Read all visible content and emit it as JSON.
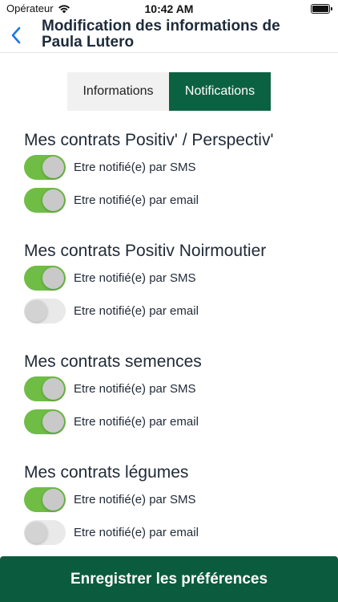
{
  "status_bar": {
    "carrier": "Opérateur",
    "time": "10:42 AM"
  },
  "header": {
    "back_icon": "chevron-left-icon",
    "title": "Modification des informations de Paula Lutero"
  },
  "tabs": [
    {
      "label": "Informations",
      "selected": false
    },
    {
      "label": "Notifications",
      "selected": true
    }
  ],
  "sections": [
    {
      "title": "Mes contrats Positiv' / Perspectiv'",
      "options": [
        {
          "label": "Etre notifié(e) par SMS",
          "enabled": true
        },
        {
          "label": "Etre notifié(e) par email",
          "enabled": true
        }
      ]
    },
    {
      "title": "Mes contrats Positiv Noirmoutier",
      "options": [
        {
          "label": "Etre notifié(e) par SMS",
          "enabled": true
        },
        {
          "label": "Etre notifié(e) par email",
          "enabled": false
        }
      ]
    },
    {
      "title": "Mes contrats semences",
      "options": [
        {
          "label": "Etre notifié(e) par SMS",
          "enabled": true
        },
        {
          "label": "Etre notifié(e) par email",
          "enabled": true
        }
      ]
    },
    {
      "title": "Mes contrats légumes",
      "options": [
        {
          "label": "Etre notifié(e) par SMS",
          "enabled": true
        },
        {
          "label": "Etre notifié(e) par email",
          "enabled": false
        }
      ]
    }
  ],
  "save_button": {
    "label": "Enregistrer les préférences"
  },
  "colors": {
    "brand_green": "#0b6243",
    "toggle_on": "#6fbd45",
    "toggle_off": "#e9e9ea",
    "accent_blue": "#1a7ae0"
  }
}
